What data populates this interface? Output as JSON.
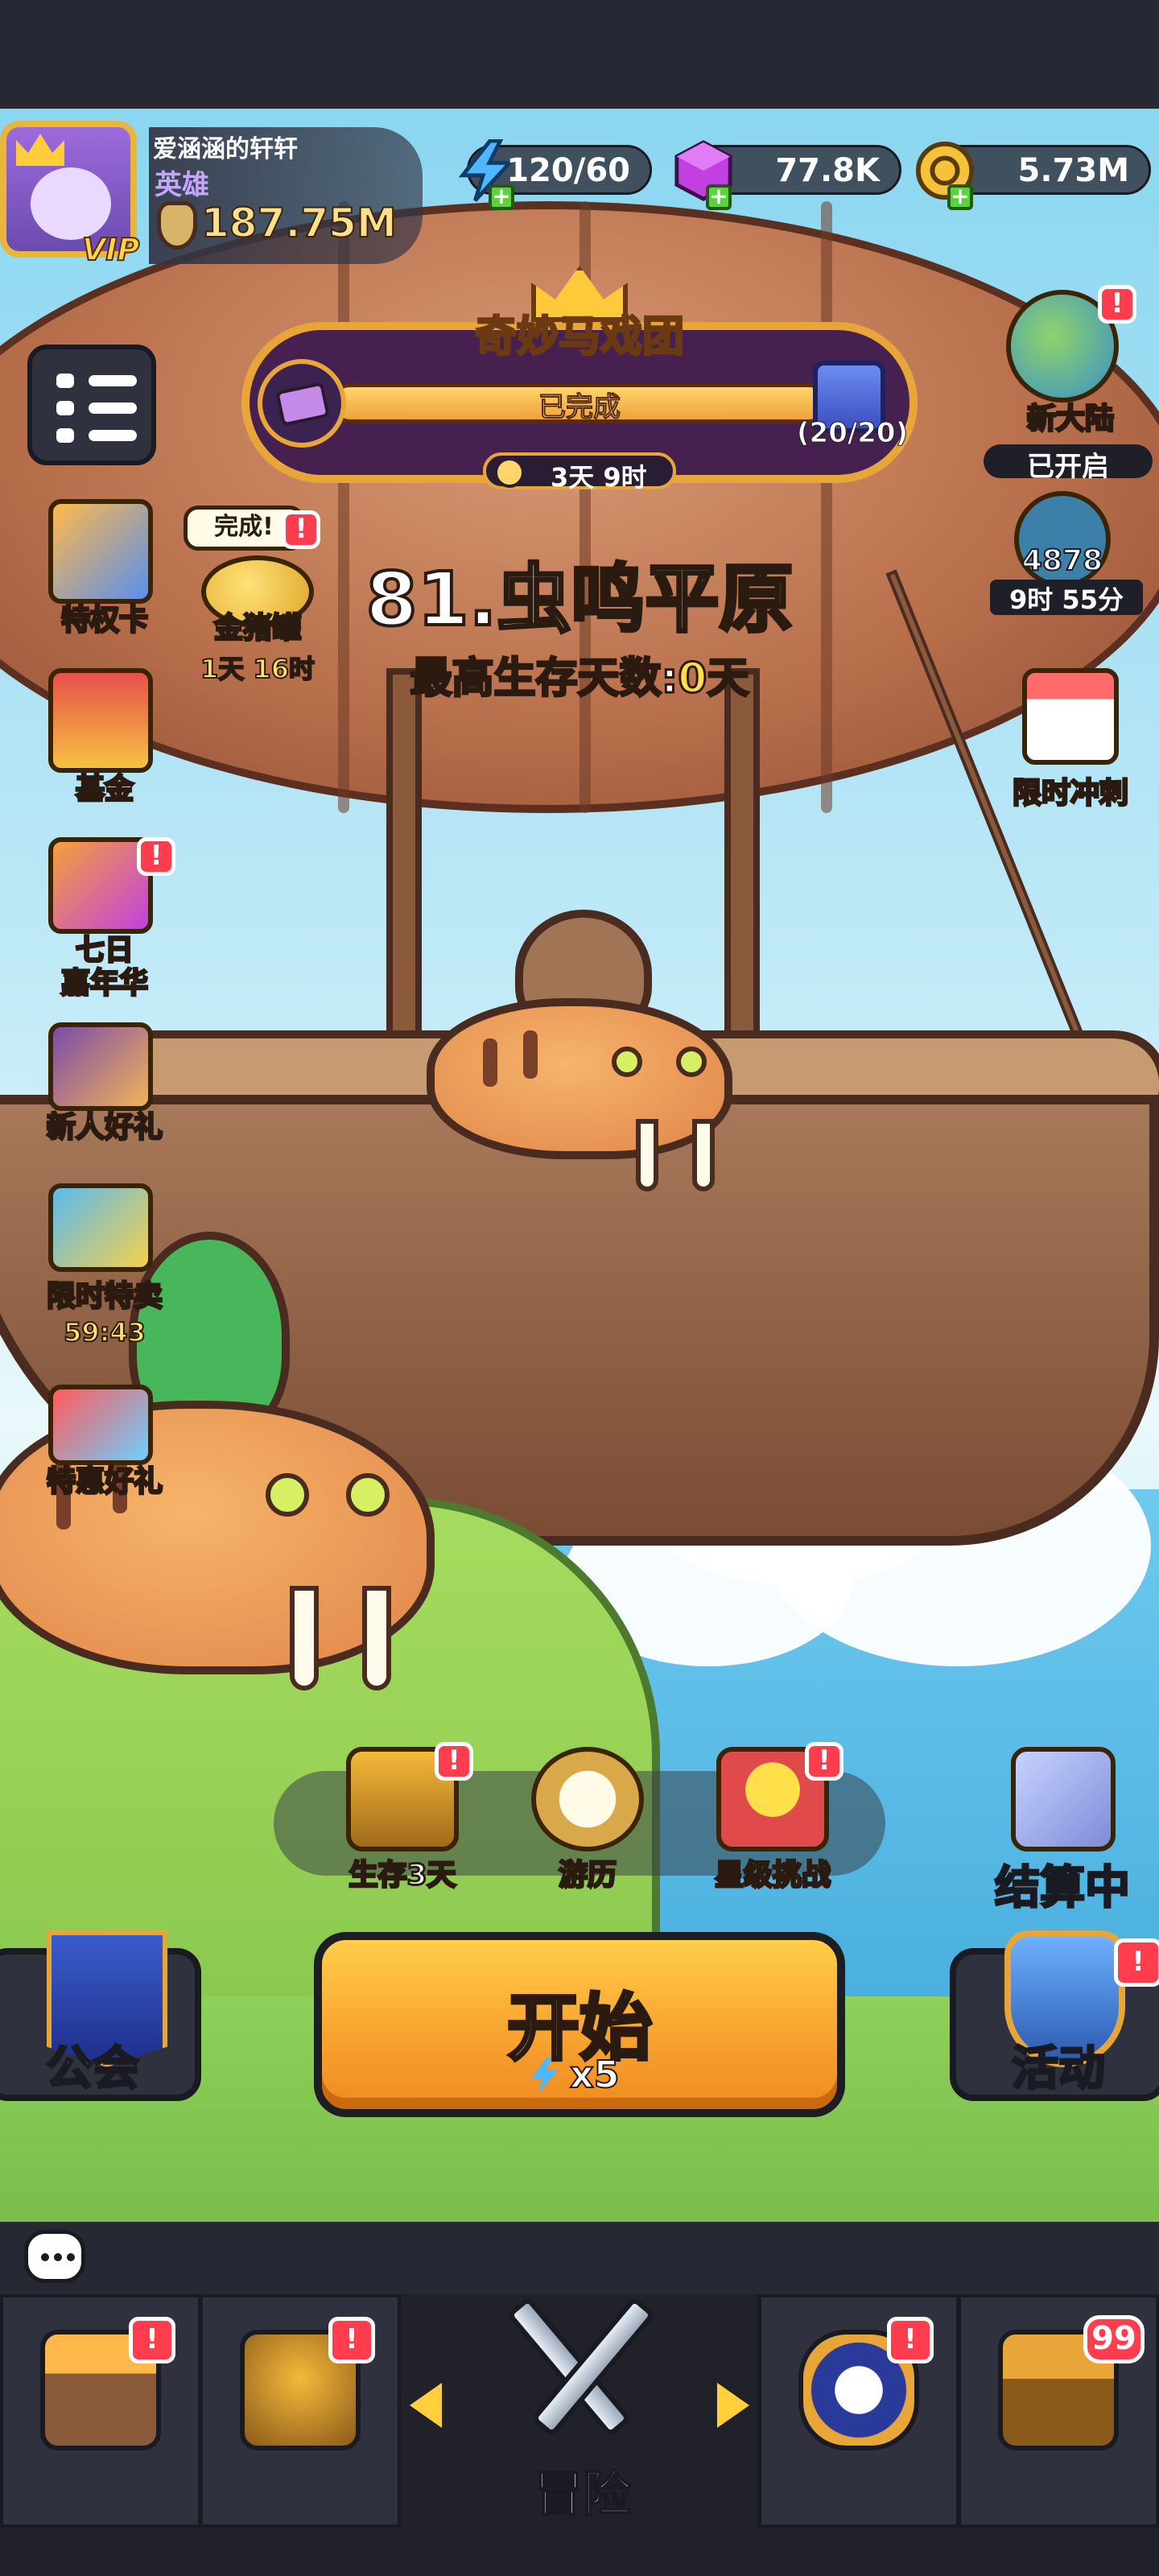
{
  "player": {
    "name": "爱涵涵的轩轩",
    "title": "英雄",
    "vip_label": "VIP",
    "power": "187.75M"
  },
  "resources": {
    "energy": "120/60",
    "gems": "77.8K",
    "coins": "5.73M"
  },
  "event": {
    "title": "奇妙马戏团",
    "progress_label": "已完成",
    "reward_count": "(20/20)",
    "timer": "3天 9时"
  },
  "right_side": {
    "new_continent_label": "新大陆",
    "new_continent_status": "已开启",
    "arena_score": "4878",
    "arena_timer": "9时 55分",
    "limited_sprint_label": "限时冲刺"
  },
  "left_side": [
    {
      "label": "特权卡"
    },
    {
      "label": "基金"
    },
    {
      "label": "七日\n嘉年华"
    },
    {
      "label": "新人好礼"
    },
    {
      "label": "限时特卖",
      "timer": "59:43"
    },
    {
      "label": "特惠好礼"
    }
  ],
  "piggy": {
    "bubble": "完成!",
    "label": "金猪罐",
    "timer": "1天 16时"
  },
  "stage": {
    "title": "81.虫鸣平原",
    "survival_prefix": "最高生存天数:",
    "survival_days": "0",
    "survival_suffix": "天"
  },
  "quick": [
    {
      "label": "生存3天"
    },
    {
      "label": "游历"
    },
    {
      "label": "星级挑战"
    }
  ],
  "settle_label": "结算中",
  "start": {
    "label": "开始",
    "cost": "x5"
  },
  "guild_label": "公会",
  "activity_label": "活动",
  "nav": {
    "center_label": "冒险",
    "chest_count": "99"
  },
  "colors": {
    "accent": "#f9a431",
    "badge": "#ff3d4e",
    "bar_bg": "#262833"
  }
}
